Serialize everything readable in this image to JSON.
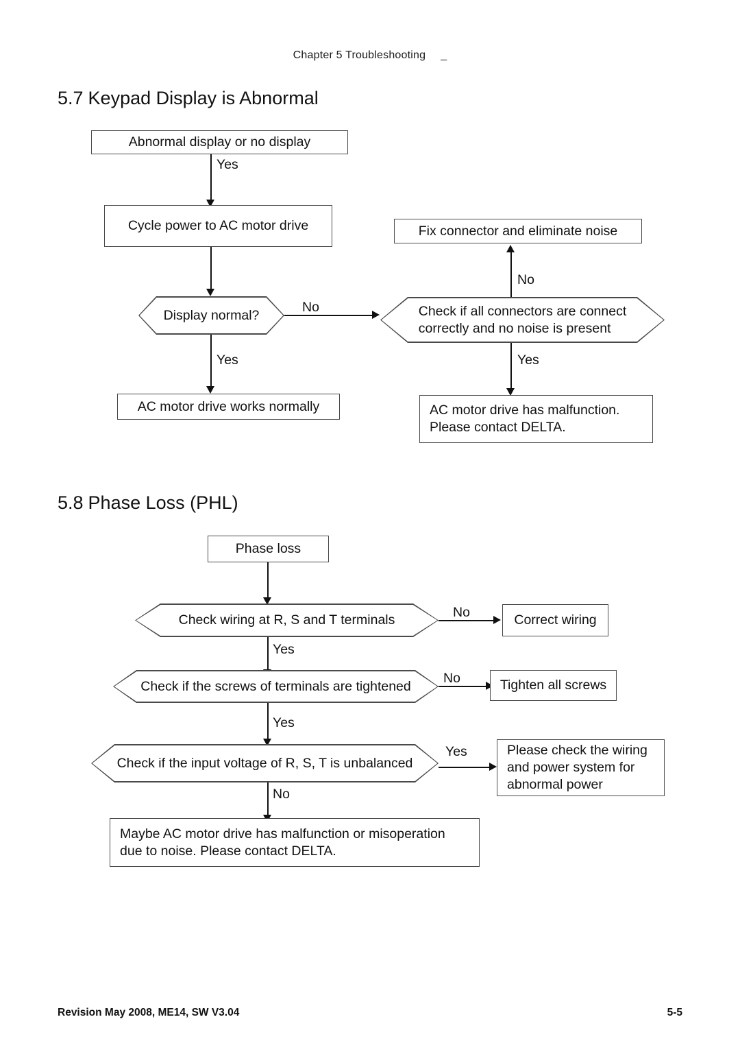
{
  "page": {
    "header": {
      "chapter": "Chapter 5 Troubleshooting",
      "mark": "_"
    },
    "footer": {
      "revision": "Revision May 2008, ME14, SW V3.04",
      "page_number": "5-5"
    }
  },
  "sections": [
    {
      "number": "5.7",
      "title": "Keypad Display is Abnormal",
      "flowchart": {
        "nodes": {
          "start": "Abnormal display or no display",
          "cycle_power": "Cycle power to AC motor drive",
          "display_normal": "Display normal?",
          "works_normally": "AC motor drive works normally",
          "fix_connector": "Fix connector and eliminate noise",
          "check_connectors_line1": "Check if all connectors are connect",
          "check_connectors_line2": "correctly and no noise is present",
          "malfunction_line1": "AC motor drive has malfunction.",
          "malfunction_line2": "Please contact DELTA."
        },
        "edges": {
          "start_to_cycle": "Yes",
          "display_no": "No",
          "display_yes": "Yes",
          "connectors_no": "No",
          "connectors_yes": "Yes"
        }
      }
    },
    {
      "number": "5.8",
      "title": "Phase Loss (PHL)",
      "flowchart": {
        "nodes": {
          "start": "Phase loss",
          "check_wiring": "Check wiring at R, S and T terminals",
          "correct_wiring": "Correct wiring",
          "check_screws": "Check if the screws of terminals are tightened",
          "tighten_screws": "Tighten all screws",
          "check_voltage": "Check if the input voltage of R, S, T is unbalanced",
          "check_power_line1": "Please check the wiring",
          "check_power_line2": "and power system for",
          "check_power_line3": "abnormal power",
          "maybe_malfunction_line1": "Maybe AC motor drive has malfunction or misoperation",
          "maybe_malfunction_line2": "due to noise. Please contact DELTA."
        },
        "edges": {
          "wiring_no": "No",
          "wiring_yes": "Yes",
          "screws_no": "No",
          "screws_yes": "Yes",
          "voltage_yes": "Yes",
          "voltage_no": "No"
        }
      }
    }
  ]
}
